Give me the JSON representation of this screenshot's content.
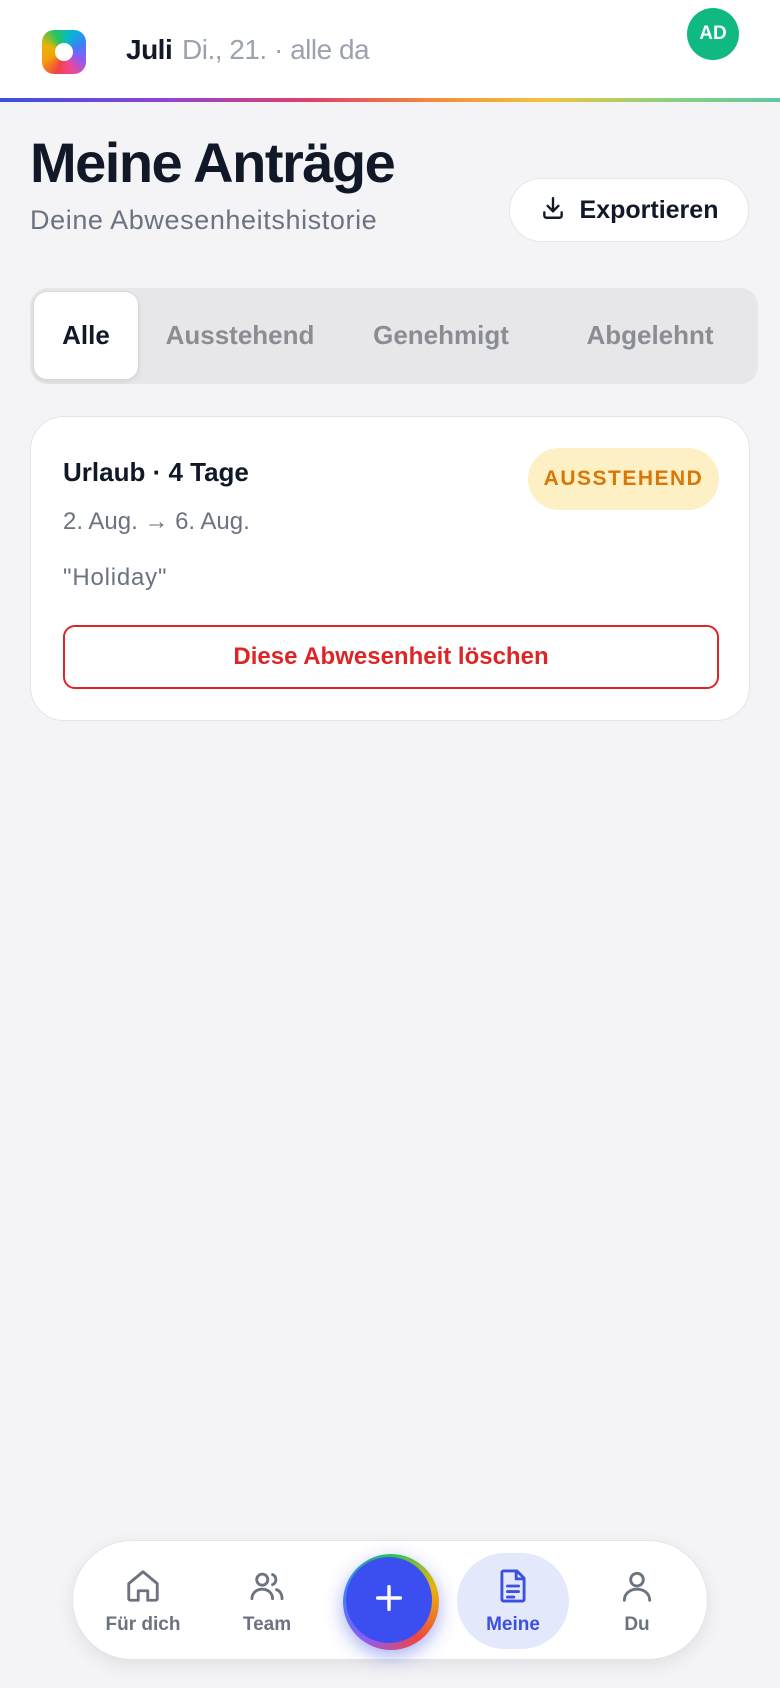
{
  "header": {
    "month": "Juli",
    "date_status": "Di., 21. · alle da",
    "avatar_initials": "AD",
    "avatar_color": "#10b981"
  },
  "page": {
    "title": "Meine Anträge",
    "subtitle": "Deine Abwesenheitshistorie",
    "export_label": "Exportieren"
  },
  "tabs": [
    {
      "label": "Alle",
      "active": true
    },
    {
      "label": "Ausstehend",
      "active": false
    },
    {
      "label": "Genehmigt",
      "active": false
    },
    {
      "label": "Abgelehnt",
      "active": false
    }
  ],
  "requests": [
    {
      "title": "Urlaub · 4 Tage",
      "dates": "2. Aug. → 6. Aug.",
      "note": "\"Holiday\"",
      "status": "AUSSTEHEND",
      "status_color": "#d97706",
      "delete_label": "Diese Abwesenheit löschen"
    }
  ],
  "bottom_nav": {
    "items": [
      {
        "label": "Für dich",
        "icon": "home-icon"
      },
      {
        "label": "Team",
        "icon": "users-icon"
      },
      {
        "label": "Meine",
        "icon": "document-icon",
        "active": true
      },
      {
        "label": "Du",
        "icon": "user-icon"
      }
    ],
    "fab_icon": "plus-icon",
    "accent_color": "#3b4ff0"
  }
}
